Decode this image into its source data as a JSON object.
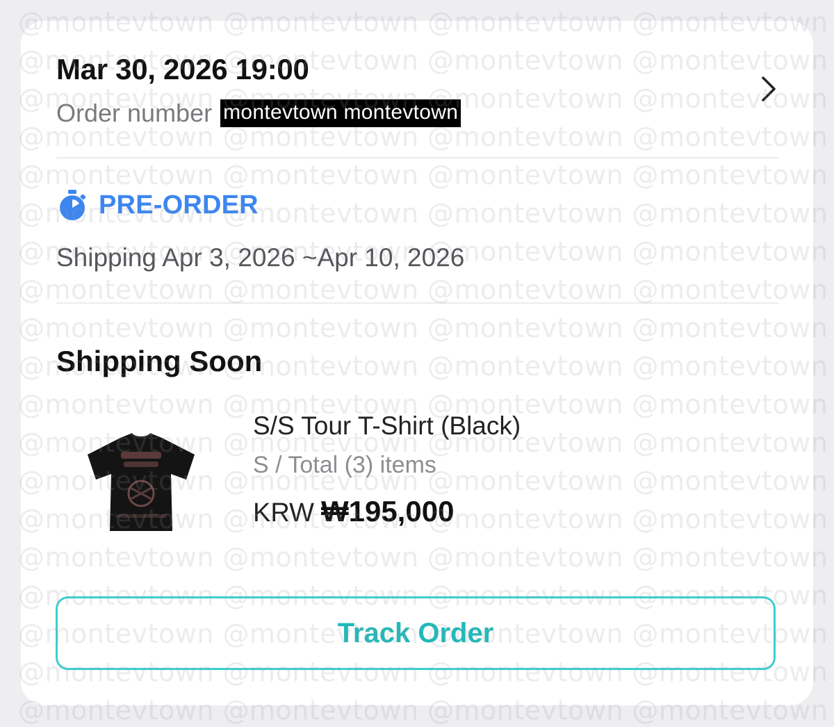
{
  "order": {
    "datetime": "Mar 30, 2026 19:00",
    "number_label": "Order number",
    "number_value": "montevtown montevtown"
  },
  "preorder": {
    "label": "PRE-ORDER",
    "icon": "stopwatch-icon",
    "shipping_dates": "Shipping Apr 3, 2026 ~Apr 10, 2026"
  },
  "status": {
    "title": "Shipping Soon"
  },
  "product": {
    "name": "S/S Tour T-Shirt (Black)",
    "options": "S / Total (3) items",
    "currency": "KRW",
    "price": "₩195,000",
    "image": "t-shirt-image"
  },
  "actions": {
    "track_label": "Track Order"
  },
  "watermark": {
    "text": "@montevtown @montevtown @montevtown @montevtown"
  },
  "colors": {
    "accent_blue": "#3d86f0",
    "accent_teal": "#22b9b9",
    "button_border": "#3bcfcf",
    "redaction_bg": "#000000"
  }
}
